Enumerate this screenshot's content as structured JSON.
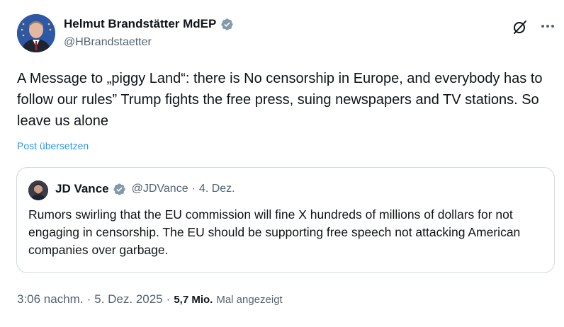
{
  "colors": {
    "text": "#0f1419",
    "secondary": "#536471",
    "link": "#1d9bf0",
    "verified": "#829aab",
    "border": "#cfd9de"
  },
  "author": {
    "display_name": "Helmut Brandstätter MdEP",
    "handle": "@HBrandstaetter",
    "verified": true
  },
  "icons": {
    "verified": "verified-badge-icon",
    "grok": "grok-icon",
    "more": "more-options-icon"
  },
  "tweet": {
    "text": "A Message to „piggy Land“: there is No censorship in Europe, and everybody has to follow our rules” Trump fights the free press, suing newspapers and TV stations. So leave us alone",
    "translate_label": "Post übersetzen"
  },
  "quoted": {
    "display_name": "JD Vance",
    "handle": "@JDVance",
    "separator": "·",
    "date": "4. Dez.",
    "text": "Rumors swirling that the EU commission will fine X hundreds of millions of dollars for not engaging in censorship. The EU should be supporting free speech not attacking American companies over garbage."
  },
  "meta": {
    "time": "3:06 nachm.",
    "separator1": "·",
    "date": "5. Dez. 2025",
    "separator2": "·",
    "views_count": "5,7 Mio.",
    "views_label": "Mal angezeigt"
  }
}
